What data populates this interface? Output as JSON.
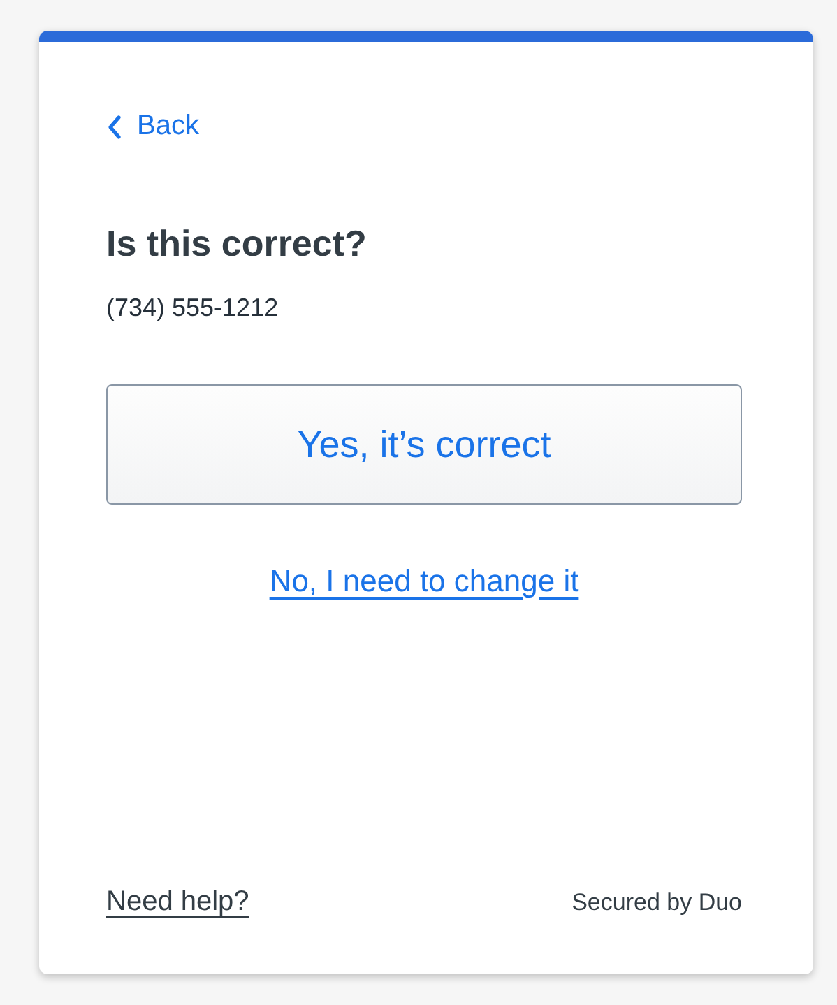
{
  "back_link": "Back",
  "heading": "Is this correct?",
  "phone_number": "(734) 555-1212",
  "confirm_button": "Yes, it’s correct",
  "change_link": "No, I need to change it",
  "footer": {
    "help_link": "Need help?",
    "secured_by": "Secured by Duo"
  }
}
